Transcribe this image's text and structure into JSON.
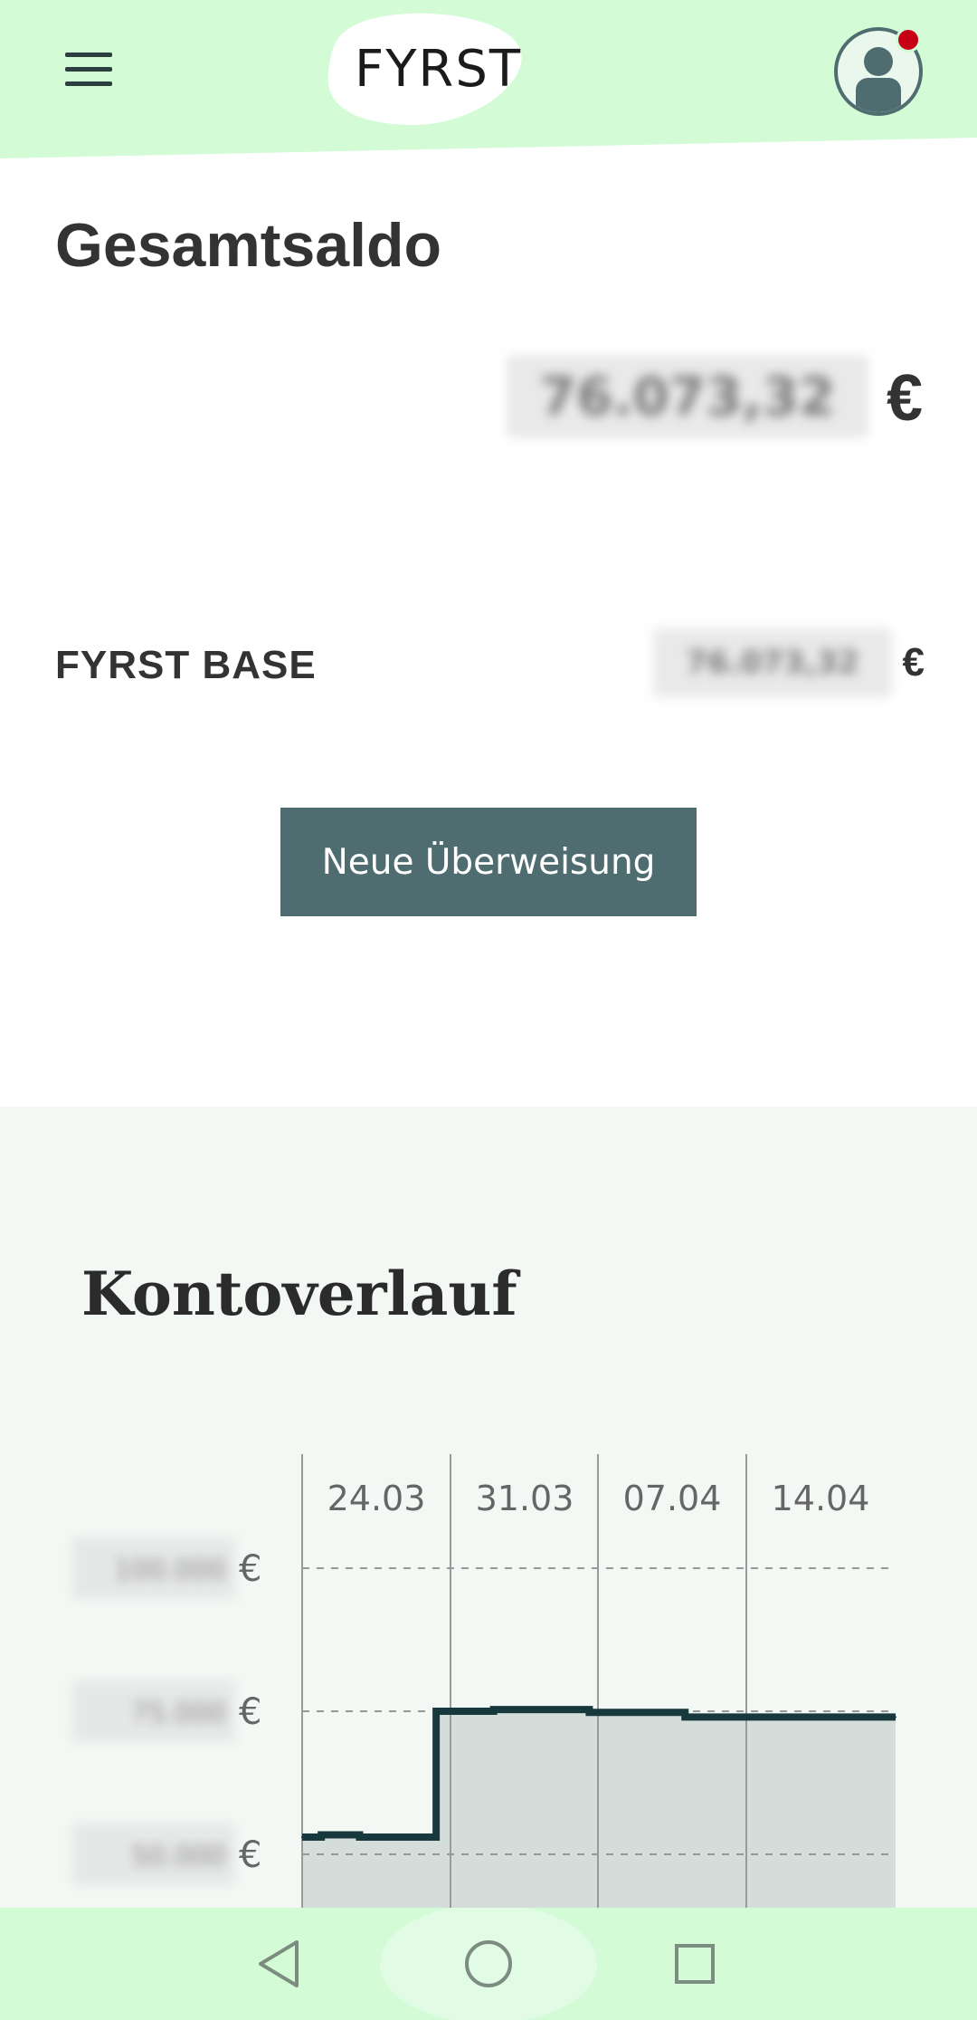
{
  "header": {
    "logo_text": "FYRST",
    "menu_icon": "hamburger-menu-icon",
    "avatar_icon": "user-avatar-icon",
    "notification_color": "#c70016"
  },
  "balance": {
    "title": "Gesamtsaldo",
    "total_amount": "76.073,32",
    "currency": "€"
  },
  "account": {
    "name": "FYRST BASE",
    "amount": "76.073,32",
    "currency": "€"
  },
  "actions": {
    "new_transfer_label": "Neue Überweisung"
  },
  "chart_section": {
    "title": "Kontoverlauf"
  },
  "chart_data": {
    "type": "area",
    "title": "Kontoverlauf",
    "x_tick_labels": [
      "24.03",
      "31.03",
      "07.04",
      "14.04"
    ],
    "y_tick_labels": [
      {
        "value_text": "100.000",
        "currency": "€"
      },
      {
        "value_text": "75.000",
        "currency": "€"
      },
      {
        "value_text": "50.000",
        "currency": "€"
      }
    ],
    "series": [
      {
        "points": [
          {
            "x": "20.03",
            "y": 53000
          },
          {
            "x": "21.03",
            "y": 53400
          },
          {
            "x": "23.03",
            "y": 53000
          },
          {
            "x": "27.03",
            "y": 75000
          },
          {
            "x": "30.03",
            "y": 75300
          },
          {
            "x": "04.04",
            "y": 74800
          },
          {
            "x": "09.04",
            "y": 74000
          },
          {
            "x": "20.04",
            "y": 74000
          }
        ]
      }
    ],
    "line_color": "#17393d",
    "fill_color": "#d5dddb",
    "grid": "dashed horizontal",
    "values_blurred": true
  },
  "navbar": {
    "back_icon": "back-triangle-icon",
    "home_icon": "home-circle-icon",
    "recents_icon": "recents-square-icon"
  },
  "colors": {
    "header_bg": "#d2fbd6",
    "accent": "#4f6d70",
    "chart_bg": "#f3f8f4"
  }
}
